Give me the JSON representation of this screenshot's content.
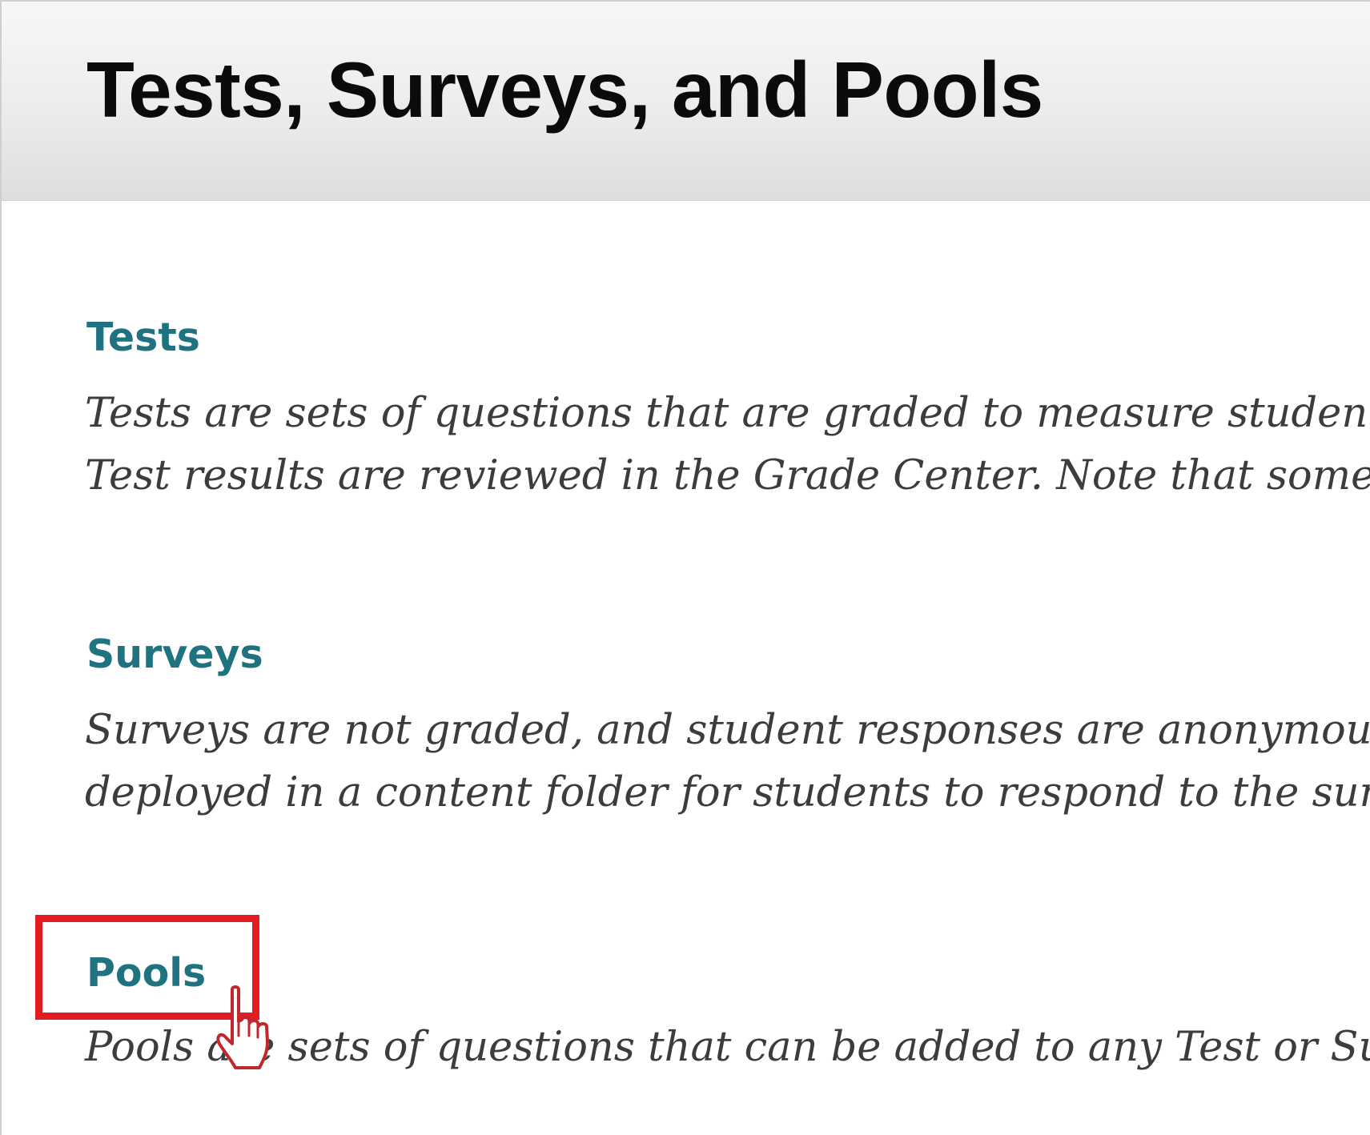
{
  "header": {
    "title": "Tests, Surveys, and Pools"
  },
  "sections": [
    {
      "link_label": "Tests",
      "description_lines": [
        "Tests are sets of questions that are graded to measure student",
        "Test results are reviewed in the Grade Center. Note that some"
      ]
    },
    {
      "link_label": "Surveys",
      "description_lines": [
        "Surveys are not graded, and student responses are anonymou",
        "deployed in a content folder for students to respond to the sur"
      ]
    },
    {
      "link_label": "Pools",
      "description_lines": [
        "Pools are sets of questions that can be added to any Test or Su"
      ]
    }
  ],
  "annotation": {
    "highlight_color": "#e31b23",
    "cursor_icon": "hand-pointer-icon"
  },
  "colors": {
    "link": "#1f7280",
    "title": "#0b0b0b",
    "body_text": "#3c3c3c"
  }
}
